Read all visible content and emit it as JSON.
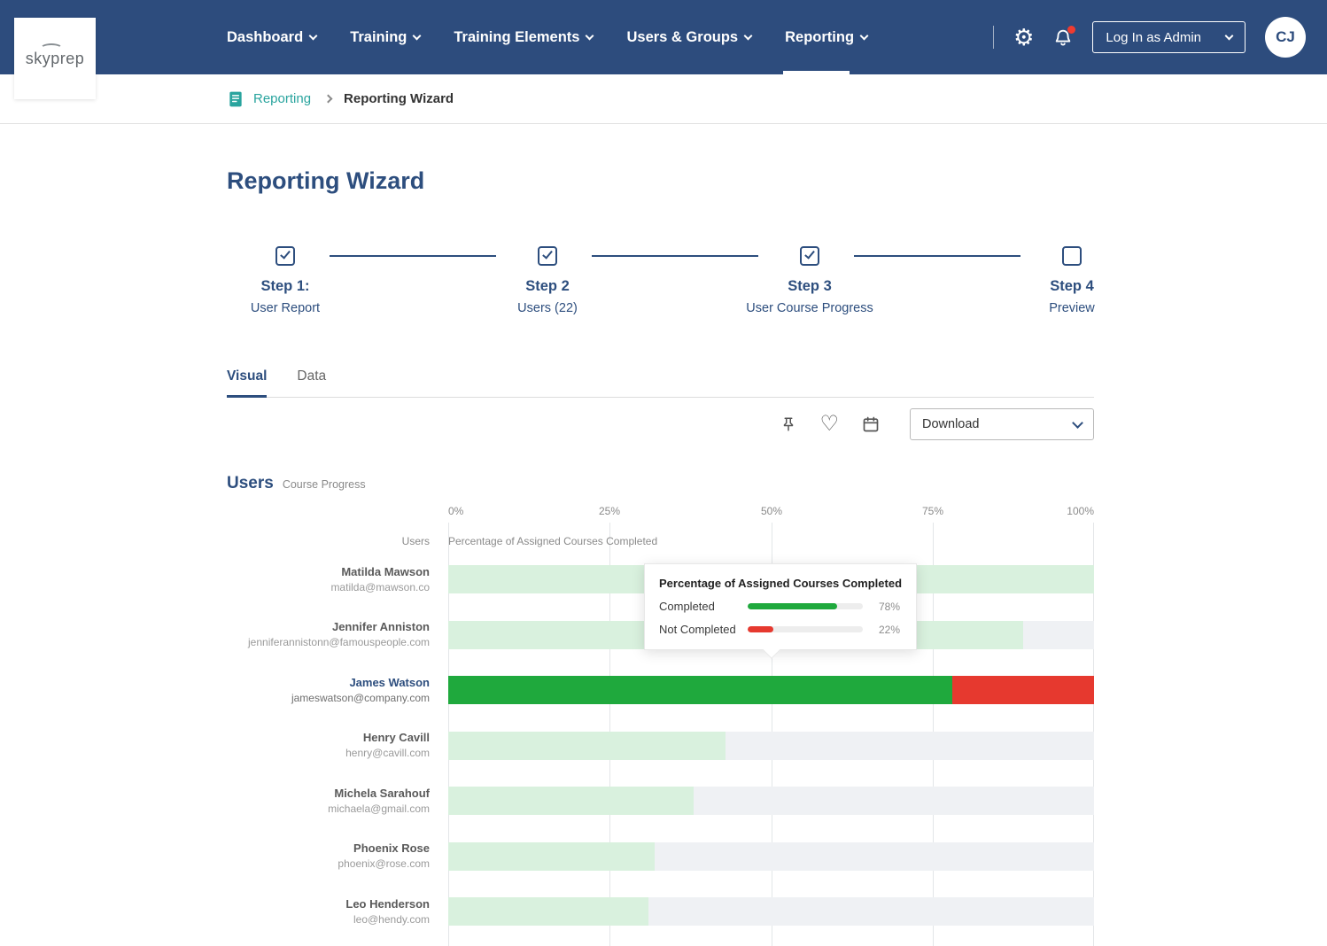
{
  "navbar": {
    "logo": "skyprep",
    "items": [
      {
        "label": "Dashboard"
      },
      {
        "label": "Training"
      },
      {
        "label": "Training Elements"
      },
      {
        "label": "Users & Groups"
      },
      {
        "label": "Reporting"
      }
    ],
    "login_label": "Log In as Admin",
    "avatar": "CJ"
  },
  "breadcrumb": {
    "parent": "Reporting",
    "current": "Reporting Wizard"
  },
  "page_title": "Reporting Wizard",
  "stepper": {
    "steps": [
      {
        "title": "Step 1:",
        "subtitle": "User Report",
        "checked": true
      },
      {
        "title": "Step 2",
        "subtitle": "Users (22)",
        "checked": true
      },
      {
        "title": "Step 3",
        "subtitle": "User Course Progress",
        "checked": true
      },
      {
        "title": "Step 4",
        "subtitle": "Preview",
        "checked": false
      }
    ]
  },
  "tabs": {
    "visual": "Visual",
    "data": "Data"
  },
  "toolbar": {
    "download": "Download"
  },
  "section": {
    "title": "Users",
    "subtitle": "Course Progress",
    "users_col": "Users",
    "metric_col": "Percentage of Assigned Courses Completed"
  },
  "axis": {
    "ticks": [
      "0%",
      "25%",
      "50%",
      "75%",
      "100%"
    ]
  },
  "tooltip": {
    "title": "Percentage of Assigned Courses Completed",
    "completed_label": "Completed",
    "completed_value": "78%",
    "completed_pct": 78,
    "not_completed_label": "Not Completed",
    "not_completed_value": "22%",
    "not_completed_pct": 22
  },
  "colors": {
    "navy": "#2d4c7d",
    "teal": "#29a49e",
    "completed": "#1fa93d",
    "completed_light": "#d9f1de",
    "not_completed": "#e6392f",
    "track": "#eff1f4",
    "notification": "#ef3b30"
  },
  "chart_data": {
    "type": "bar",
    "orientation": "horizontal",
    "title": "Users — Course Progress",
    "xlabel": "Percentage of Assigned Courses Completed",
    "xlim": [
      0,
      100
    ],
    "x_ticks": [
      "0%",
      "25%",
      "50%",
      "75%",
      "100%"
    ],
    "rows": [
      {
        "name": "Matilda Mawson",
        "email": "matilda@mawson.co",
        "completed_pct": 100,
        "not_completed_pct": 0,
        "highlight": false
      },
      {
        "name": "Jennifer Anniston",
        "email": "jenniferannistonn@famouspeople.com",
        "completed_pct": 89,
        "not_completed_pct": 0,
        "highlight": false
      },
      {
        "name": "James Watson",
        "email": "jameswatson@company.com",
        "completed_pct": 78,
        "not_completed_pct": 22,
        "highlight": true
      },
      {
        "name": "Henry Cavill",
        "email": "henry@cavill.com",
        "completed_pct": 43,
        "not_completed_pct": 0,
        "highlight": false
      },
      {
        "name": "Michela Sarahouf",
        "email": "michaela@gmail.com",
        "completed_pct": 38,
        "not_completed_pct": 0,
        "highlight": false
      },
      {
        "name": "Phoenix Rose",
        "email": "phoenix@rose.com",
        "completed_pct": 32,
        "not_completed_pct": 0,
        "highlight": false
      },
      {
        "name": "Leo Henderson",
        "email": "leo@hendy.com",
        "completed_pct": 31,
        "not_completed_pct": 0,
        "highlight": false
      }
    ]
  }
}
